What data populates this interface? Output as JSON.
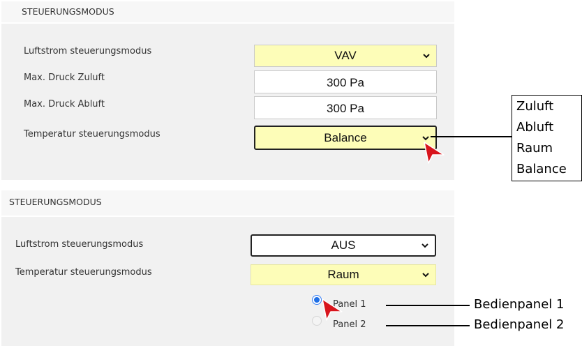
{
  "panel1": {
    "title": "STEUERUNGSMODUS",
    "rows": [
      {
        "label": "Luftstrom steuerungsmodus",
        "value": "VAV"
      },
      {
        "label": "Max. Druck Zuluft",
        "value": "300 Pa"
      },
      {
        "label": "Max. Druck Abluft",
        "value": "300 Pa"
      },
      {
        "label": "Temperatur steuerungsmodus",
        "value": "Balance"
      }
    ]
  },
  "callout": {
    "options": [
      "Zuluft",
      "Abluft",
      "Raum",
      "Balance"
    ]
  },
  "panel2": {
    "title": "STEUERUNGSMODUS",
    "rows": [
      {
        "label": "Luftstrom steuerungsmodus",
        "value": "AUS"
      },
      {
        "label": "Temperatur steuerungsmodus",
        "value": "Raum"
      }
    ],
    "radios": [
      {
        "label": "Panel 1",
        "selected": true,
        "annotation": "Bedienpanel 1"
      },
      {
        "label": "Panel 2",
        "selected": false,
        "annotation": "Bedienpanel 2"
      }
    ]
  },
  "colors": {
    "highlight": "#fdfdb8",
    "cursor": "#d8141c",
    "radio": "#1f6fe5"
  }
}
